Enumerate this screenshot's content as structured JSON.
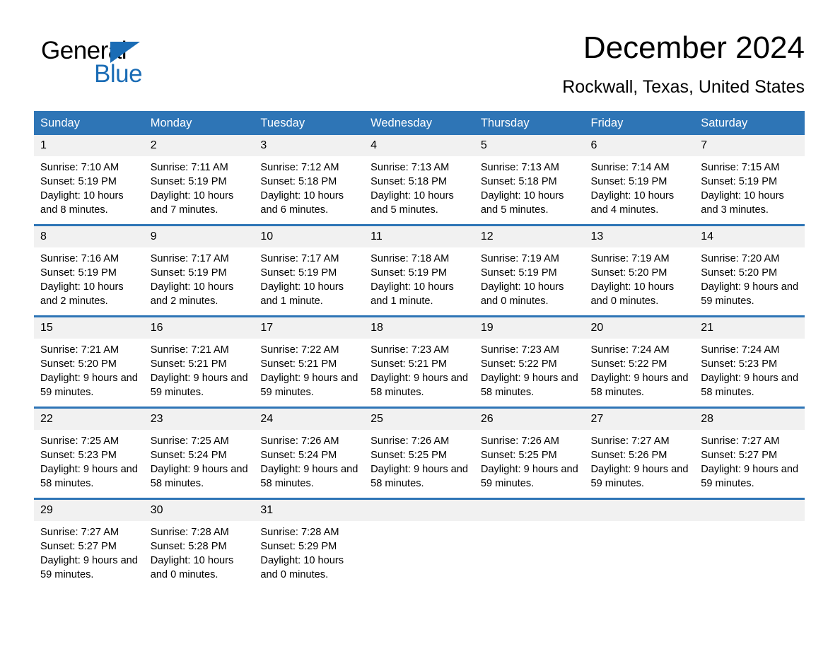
{
  "brand": {
    "name_part1": "General",
    "name_part2": "Blue",
    "accent_color": "#1a6cb5"
  },
  "header": {
    "title": "December 2024",
    "location": "Rockwall, Texas, United States"
  },
  "calendar": {
    "header_bg": "#2e75b6",
    "daynum_bg": "#f1f1f1",
    "weekday_headers": [
      "Sunday",
      "Monday",
      "Tuesday",
      "Wednesday",
      "Thursday",
      "Friday",
      "Saturday"
    ],
    "weeks": [
      [
        {
          "day": "1",
          "info": "Sunrise: 7:10 AM\nSunset: 5:19 PM\nDaylight: 10 hours and 8 minutes."
        },
        {
          "day": "2",
          "info": "Sunrise: 7:11 AM\nSunset: 5:19 PM\nDaylight: 10 hours and 7 minutes."
        },
        {
          "day": "3",
          "info": "Sunrise: 7:12 AM\nSunset: 5:18 PM\nDaylight: 10 hours and 6 minutes."
        },
        {
          "day": "4",
          "info": "Sunrise: 7:13 AM\nSunset: 5:18 PM\nDaylight: 10 hours and 5 minutes."
        },
        {
          "day": "5",
          "info": "Sunrise: 7:13 AM\nSunset: 5:18 PM\nDaylight: 10 hours and 5 minutes."
        },
        {
          "day": "6",
          "info": "Sunrise: 7:14 AM\nSunset: 5:19 PM\nDaylight: 10 hours and 4 minutes."
        },
        {
          "day": "7",
          "info": "Sunrise: 7:15 AM\nSunset: 5:19 PM\nDaylight: 10 hours and 3 minutes."
        }
      ],
      [
        {
          "day": "8",
          "info": "Sunrise: 7:16 AM\nSunset: 5:19 PM\nDaylight: 10 hours and 2 minutes."
        },
        {
          "day": "9",
          "info": "Sunrise: 7:17 AM\nSunset: 5:19 PM\nDaylight: 10 hours and 2 minutes."
        },
        {
          "day": "10",
          "info": "Sunrise: 7:17 AM\nSunset: 5:19 PM\nDaylight: 10 hours and 1 minute."
        },
        {
          "day": "11",
          "info": "Sunrise: 7:18 AM\nSunset: 5:19 PM\nDaylight: 10 hours and 1 minute."
        },
        {
          "day": "12",
          "info": "Sunrise: 7:19 AM\nSunset: 5:19 PM\nDaylight: 10 hours and 0 minutes."
        },
        {
          "day": "13",
          "info": "Sunrise: 7:19 AM\nSunset: 5:20 PM\nDaylight: 10 hours and 0 minutes."
        },
        {
          "day": "14",
          "info": "Sunrise: 7:20 AM\nSunset: 5:20 PM\nDaylight: 9 hours and 59 minutes."
        }
      ],
      [
        {
          "day": "15",
          "info": "Sunrise: 7:21 AM\nSunset: 5:20 PM\nDaylight: 9 hours and 59 minutes."
        },
        {
          "day": "16",
          "info": "Sunrise: 7:21 AM\nSunset: 5:21 PM\nDaylight: 9 hours and 59 minutes."
        },
        {
          "day": "17",
          "info": "Sunrise: 7:22 AM\nSunset: 5:21 PM\nDaylight: 9 hours and 59 minutes."
        },
        {
          "day": "18",
          "info": "Sunrise: 7:23 AM\nSunset: 5:21 PM\nDaylight: 9 hours and 58 minutes."
        },
        {
          "day": "19",
          "info": "Sunrise: 7:23 AM\nSunset: 5:22 PM\nDaylight: 9 hours and 58 minutes."
        },
        {
          "day": "20",
          "info": "Sunrise: 7:24 AM\nSunset: 5:22 PM\nDaylight: 9 hours and 58 minutes."
        },
        {
          "day": "21",
          "info": "Sunrise: 7:24 AM\nSunset: 5:23 PM\nDaylight: 9 hours and 58 minutes."
        }
      ],
      [
        {
          "day": "22",
          "info": "Sunrise: 7:25 AM\nSunset: 5:23 PM\nDaylight: 9 hours and 58 minutes."
        },
        {
          "day": "23",
          "info": "Sunrise: 7:25 AM\nSunset: 5:24 PM\nDaylight: 9 hours and 58 minutes."
        },
        {
          "day": "24",
          "info": "Sunrise: 7:26 AM\nSunset: 5:24 PM\nDaylight: 9 hours and 58 minutes."
        },
        {
          "day": "25",
          "info": "Sunrise: 7:26 AM\nSunset: 5:25 PM\nDaylight: 9 hours and 58 minutes."
        },
        {
          "day": "26",
          "info": "Sunrise: 7:26 AM\nSunset: 5:25 PM\nDaylight: 9 hours and 59 minutes."
        },
        {
          "day": "27",
          "info": "Sunrise: 7:27 AM\nSunset: 5:26 PM\nDaylight: 9 hours and 59 minutes."
        },
        {
          "day": "28",
          "info": "Sunrise: 7:27 AM\nSunset: 5:27 PM\nDaylight: 9 hours and 59 minutes."
        }
      ],
      [
        {
          "day": "29",
          "info": "Sunrise: 7:27 AM\nSunset: 5:27 PM\nDaylight: 9 hours and 59 minutes."
        },
        {
          "day": "30",
          "info": "Sunrise: 7:28 AM\nSunset: 5:28 PM\nDaylight: 10 hours and 0 minutes."
        },
        {
          "day": "31",
          "info": "Sunrise: 7:28 AM\nSunset: 5:29 PM\nDaylight: 10 hours and 0 minutes."
        },
        {
          "day": "",
          "info": ""
        },
        {
          "day": "",
          "info": ""
        },
        {
          "day": "",
          "info": ""
        },
        {
          "day": "",
          "info": ""
        }
      ]
    ]
  }
}
